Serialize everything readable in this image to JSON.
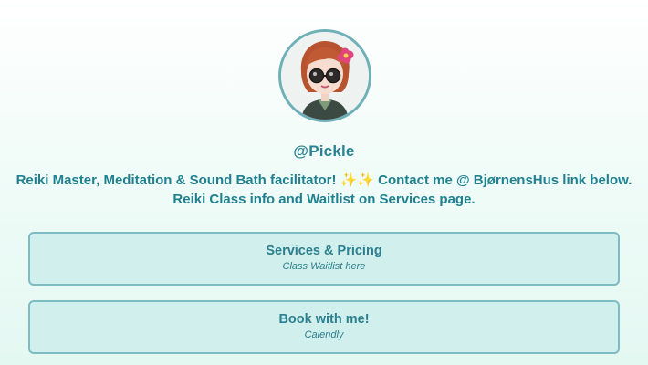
{
  "profile": {
    "handle": "@Pickle",
    "bio": "Reiki Master, Meditation & Sound Bath facilitator! ✨✨ Contact me @ BjørnensHus link below. Reiki Class info and Waitlist on Services page.",
    "avatar_icon": "cartoon-avatar-glasses-red-hair"
  },
  "links": [
    {
      "title": "Services & Pricing",
      "subtitle": "Class Waitlist here"
    },
    {
      "title": "Book with me!",
      "subtitle": "Calendly"
    }
  ],
  "colors": {
    "accent": "#2a8293",
    "card_bg": "#d1efec",
    "card_border": "#7dbcc3",
    "avatar_border": "#6fb0b8"
  }
}
